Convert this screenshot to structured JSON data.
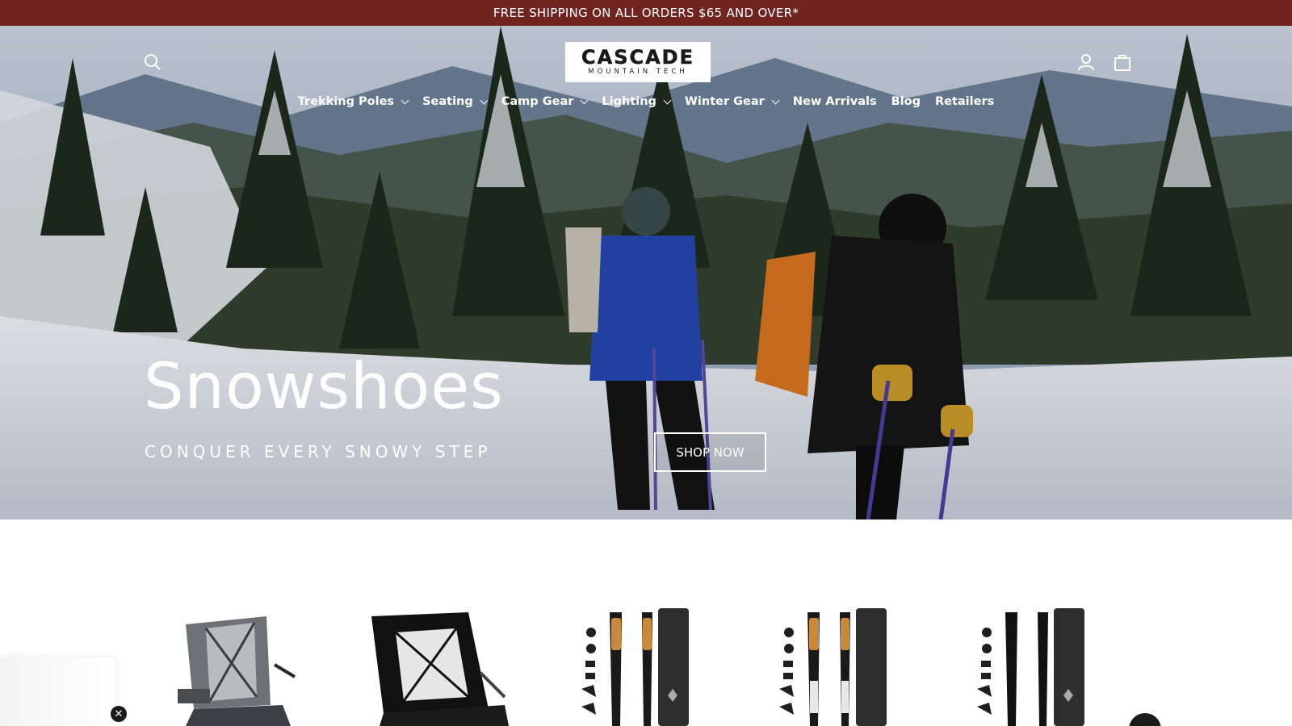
{
  "announcement": {
    "text": "FREE SHIPPING ON ALL ORDERS $65 AND OVER*"
  },
  "header": {
    "logo_main": "CASCADE",
    "logo_sub": "MOUNTAIN TECH",
    "icons": {
      "search": "search-icon",
      "account": "user-icon",
      "cart": "bag-icon"
    }
  },
  "nav": {
    "items": [
      {
        "label": "Trekking Poles",
        "dropdown": true
      },
      {
        "label": "Seating",
        "dropdown": true
      },
      {
        "label": "Camp Gear",
        "dropdown": true
      },
      {
        "label": "Lighting",
        "dropdown": true
      },
      {
        "label": "Winter Gear",
        "dropdown": true
      },
      {
        "label": "New Arrivals",
        "dropdown": false
      },
      {
        "label": "Blog",
        "dropdown": false
      },
      {
        "label": "Retailers",
        "dropdown": false
      }
    ]
  },
  "hero": {
    "title": "Snowshoes",
    "subtitle": "CONQUER EVERY SNOWY STEP",
    "button": "SHOP NOW"
  },
  "colors": {
    "announcement_bg": "#6f2420",
    "text_light": "#ffffff",
    "dark": "#1a1a1a",
    "cork": "#c8893a"
  },
  "products": [
    {
      "image": "folding-camp-chair-gray"
    },
    {
      "image": "folding-camp-chair-black"
    },
    {
      "image": "trekking-poles-cork-orange"
    },
    {
      "image": "trekking-poles-cork-white"
    },
    {
      "image": "trekking-poles-black"
    }
  ],
  "popup": {
    "close_icon": "close-icon"
  }
}
